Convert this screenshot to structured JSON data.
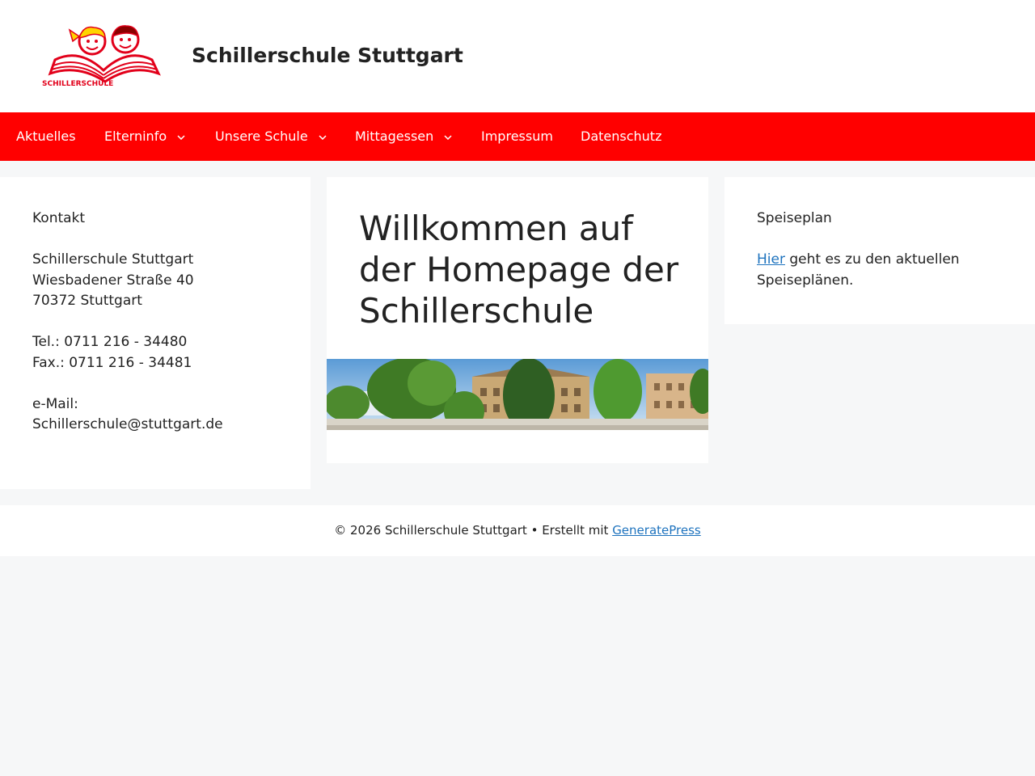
{
  "header": {
    "site_title": "Schillerschule Stuttgart",
    "logo_text": "SCHILLERSCHULE"
  },
  "nav": {
    "items": [
      {
        "label": "Aktuelles",
        "has_submenu": false
      },
      {
        "label": "Elterninfo",
        "has_submenu": true
      },
      {
        "label": "Unsere Schule",
        "has_submenu": true
      },
      {
        "label": "Mittagessen",
        "has_submenu": true
      },
      {
        "label": "Impressum",
        "has_submenu": false
      },
      {
        "label": "Datenschutz",
        "has_submenu": false
      }
    ]
  },
  "left_widget": {
    "title": "Kontakt",
    "name": "Schillerschule Stuttgart",
    "street": "Wiesbadener Straße 40",
    "city": "70372 Stuttgart",
    "tel": "Tel.: 0711 216 - 34480",
    "fax": "Fax.: 0711 216 - 34481",
    "email_label": "e-Mail:",
    "email": "Schillerschule@stuttgart.de"
  },
  "main": {
    "title": "Willkommen auf der Homepage der Schillerschule"
  },
  "right_widget": {
    "title": "Speiseplan",
    "link_text": "Hier",
    "text_after_link": " geht es zu den aktuellen",
    "text_line2": "Speiseplänen."
  },
  "footer": {
    "copyright": "© 2026 Schillerschule Stuttgart • Erstellt mit ",
    "link": "GeneratePress"
  },
  "colors": {
    "nav_bg": "#ff0000",
    "link": "#1e73be",
    "page_bg": "#f6f7f8"
  }
}
